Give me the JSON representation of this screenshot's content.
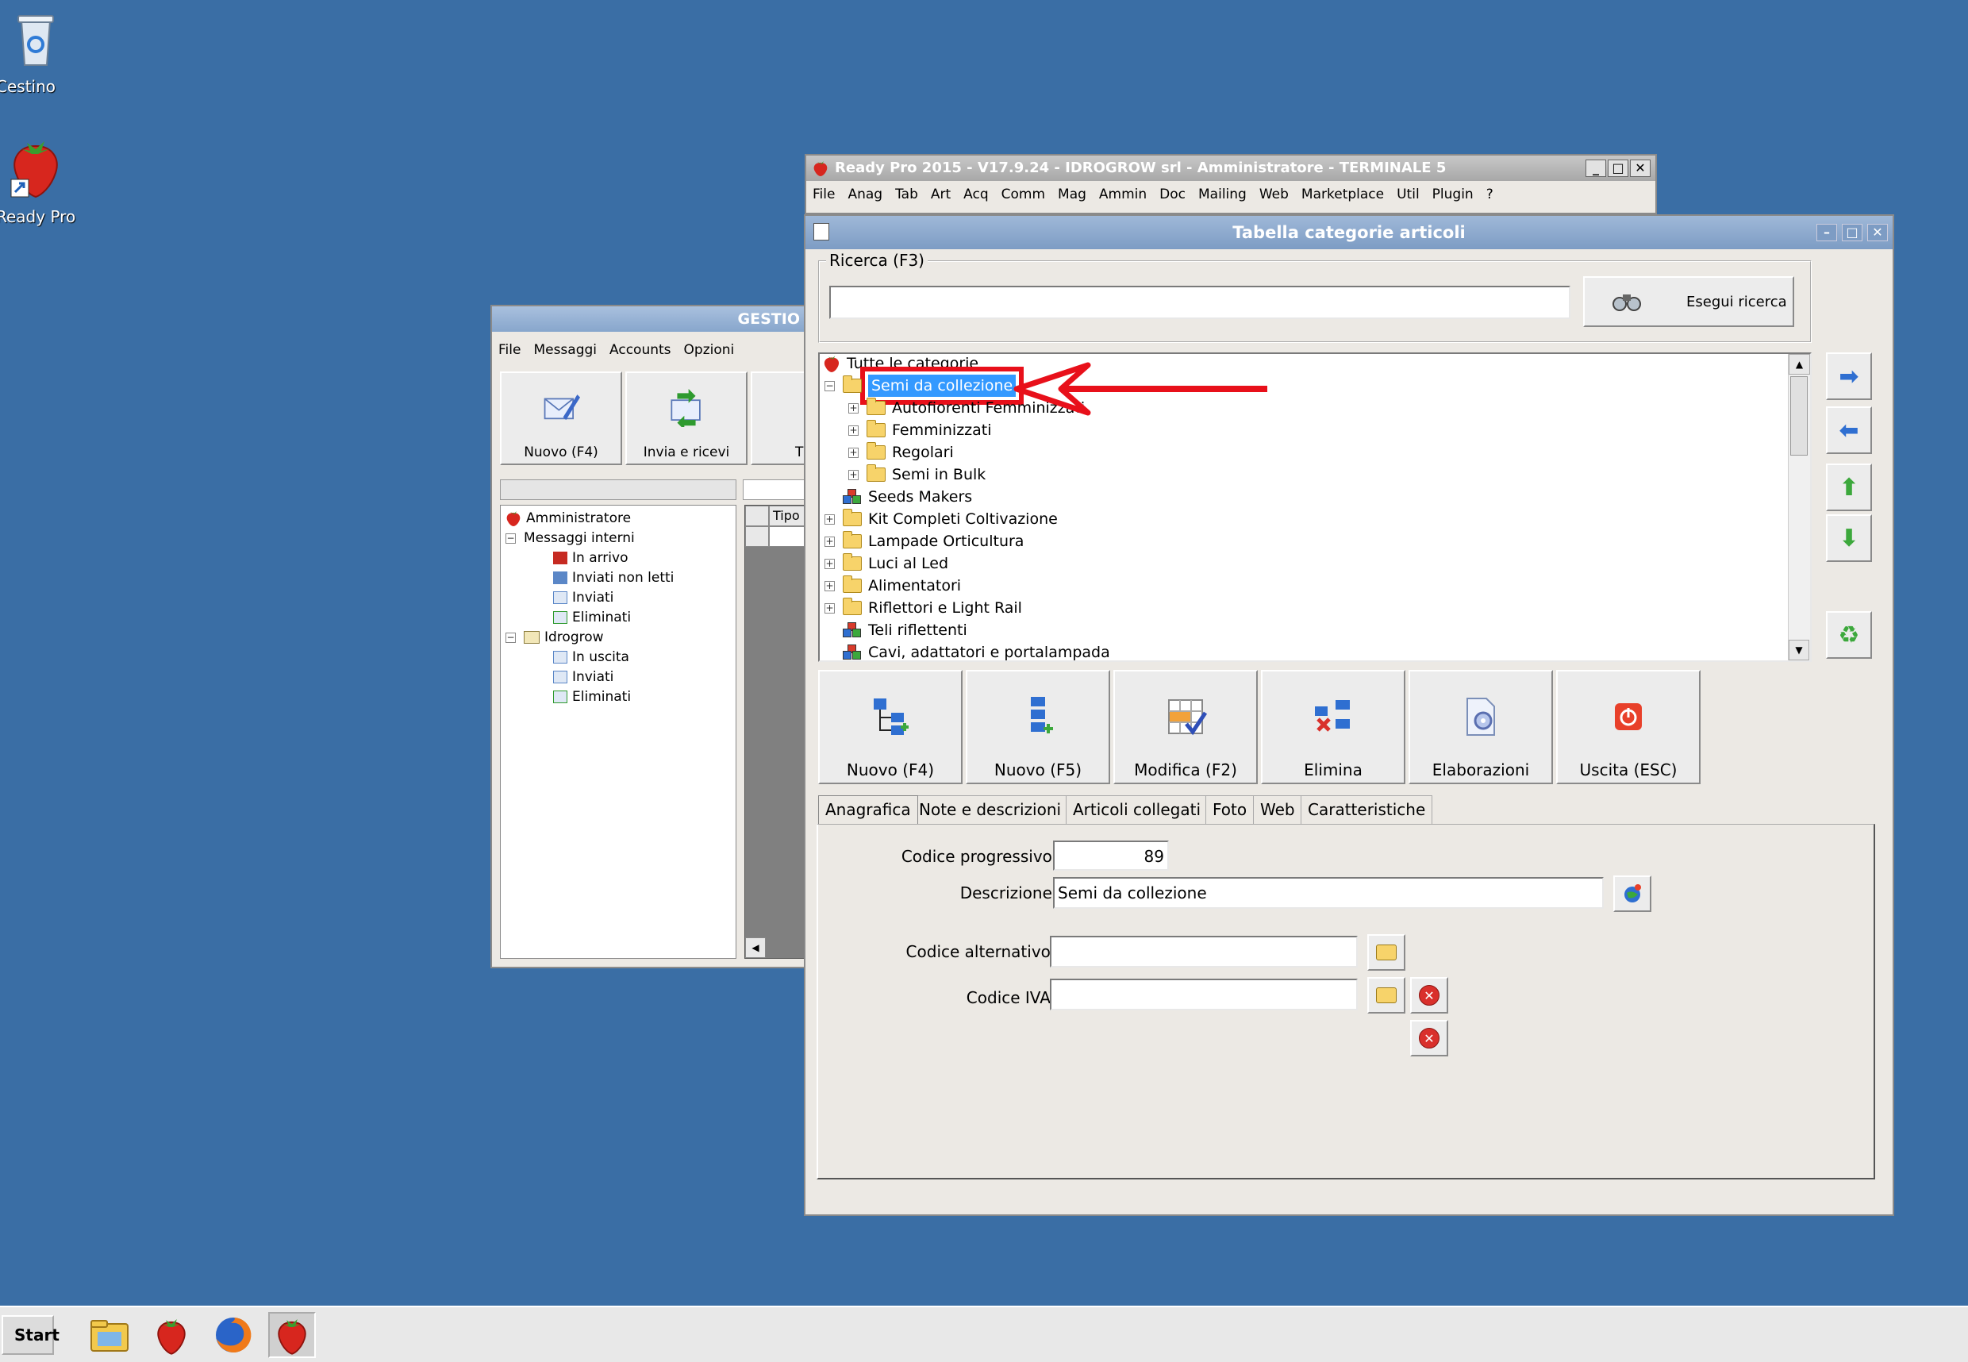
{
  "desktop": {
    "icons": [
      {
        "label": "Cestino"
      },
      {
        "label": "Ready Pro"
      }
    ]
  },
  "taskbar": {
    "start_label": "Start"
  },
  "mail_window": {
    "title": "GESTIO",
    "menu": [
      "File",
      "Messaggi",
      "Accounts",
      "Opzioni"
    ],
    "toolbar": [
      "Nuovo (F4)",
      "Invia e ricevi",
      "T"
    ],
    "grid_header": "Tipo",
    "tree": {
      "root": "Amministratore",
      "messaggi_interni": "Messaggi interni",
      "in_arrivo": "In arrivo",
      "inviati_non_letti": "Inviati non letti",
      "inviati": "Inviati",
      "eliminati": "Eliminati",
      "idrogrow": "Idrogrow",
      "in_uscita": "In uscita",
      "inviati2": "Inviati",
      "eliminati2": "Eliminati"
    }
  },
  "main_window": {
    "title": "Ready Pro 2015 - V17.9.24 - IDROGROW srl - Amministratore - TERMINALE 5",
    "menu": [
      "File",
      "Anag",
      "Tab",
      "Art",
      "Acq",
      "Comm",
      "Mag",
      "Ammin",
      "Doc",
      "Mailing",
      "Web",
      "Marketplace",
      "Util",
      "Plugin",
      "?"
    ]
  },
  "category_window": {
    "title": "Tabella categorie articoli",
    "search": {
      "group_label": "Ricerca (F3)",
      "value": "",
      "button_label": "Esegui ricerca"
    },
    "tree": {
      "root": "Tutte le categorie",
      "selected": "Semi da collezione",
      "children": [
        "Autofiorenti Femminizzati",
        "Femminizzati",
        "Regolari",
        "Semi in Bulk"
      ],
      "items": [
        "Seeds Makers",
        "Kit Completi Coltivazione",
        "Lampade Orticultura",
        "Luci al Led",
        "Alimentatori",
        "Riflettori e Light Rail",
        "Teli riflettenti",
        "Cavi, adattatori e portalampada"
      ]
    },
    "toolbar": [
      "Nuovo (F4)",
      "Nuovo (F5)",
      "Modifica (F2)",
      "Elimina",
      "Elaborazioni",
      "Uscita (ESC)"
    ],
    "tabs": [
      "Anagrafica",
      "Note e descrizioni",
      "Articoli collegati",
      "Foto",
      "Web",
      "Caratteristiche"
    ],
    "form": {
      "codice_progressivo_label": "Codice progressivo :",
      "codice_progressivo_value": "89",
      "descrizione_label": "Descrizione :",
      "descrizione_value": "Semi da collezione",
      "codice_alternativo_label": "Codice alternativo :",
      "codice_alternativo_value": "",
      "codice_iva_label": "Codice IVA :",
      "codice_iva_value": ""
    }
  },
  "colors": {
    "desktop": "#3a6ea5",
    "annotation_red": "#e8101a",
    "selection": "#3399ff"
  }
}
